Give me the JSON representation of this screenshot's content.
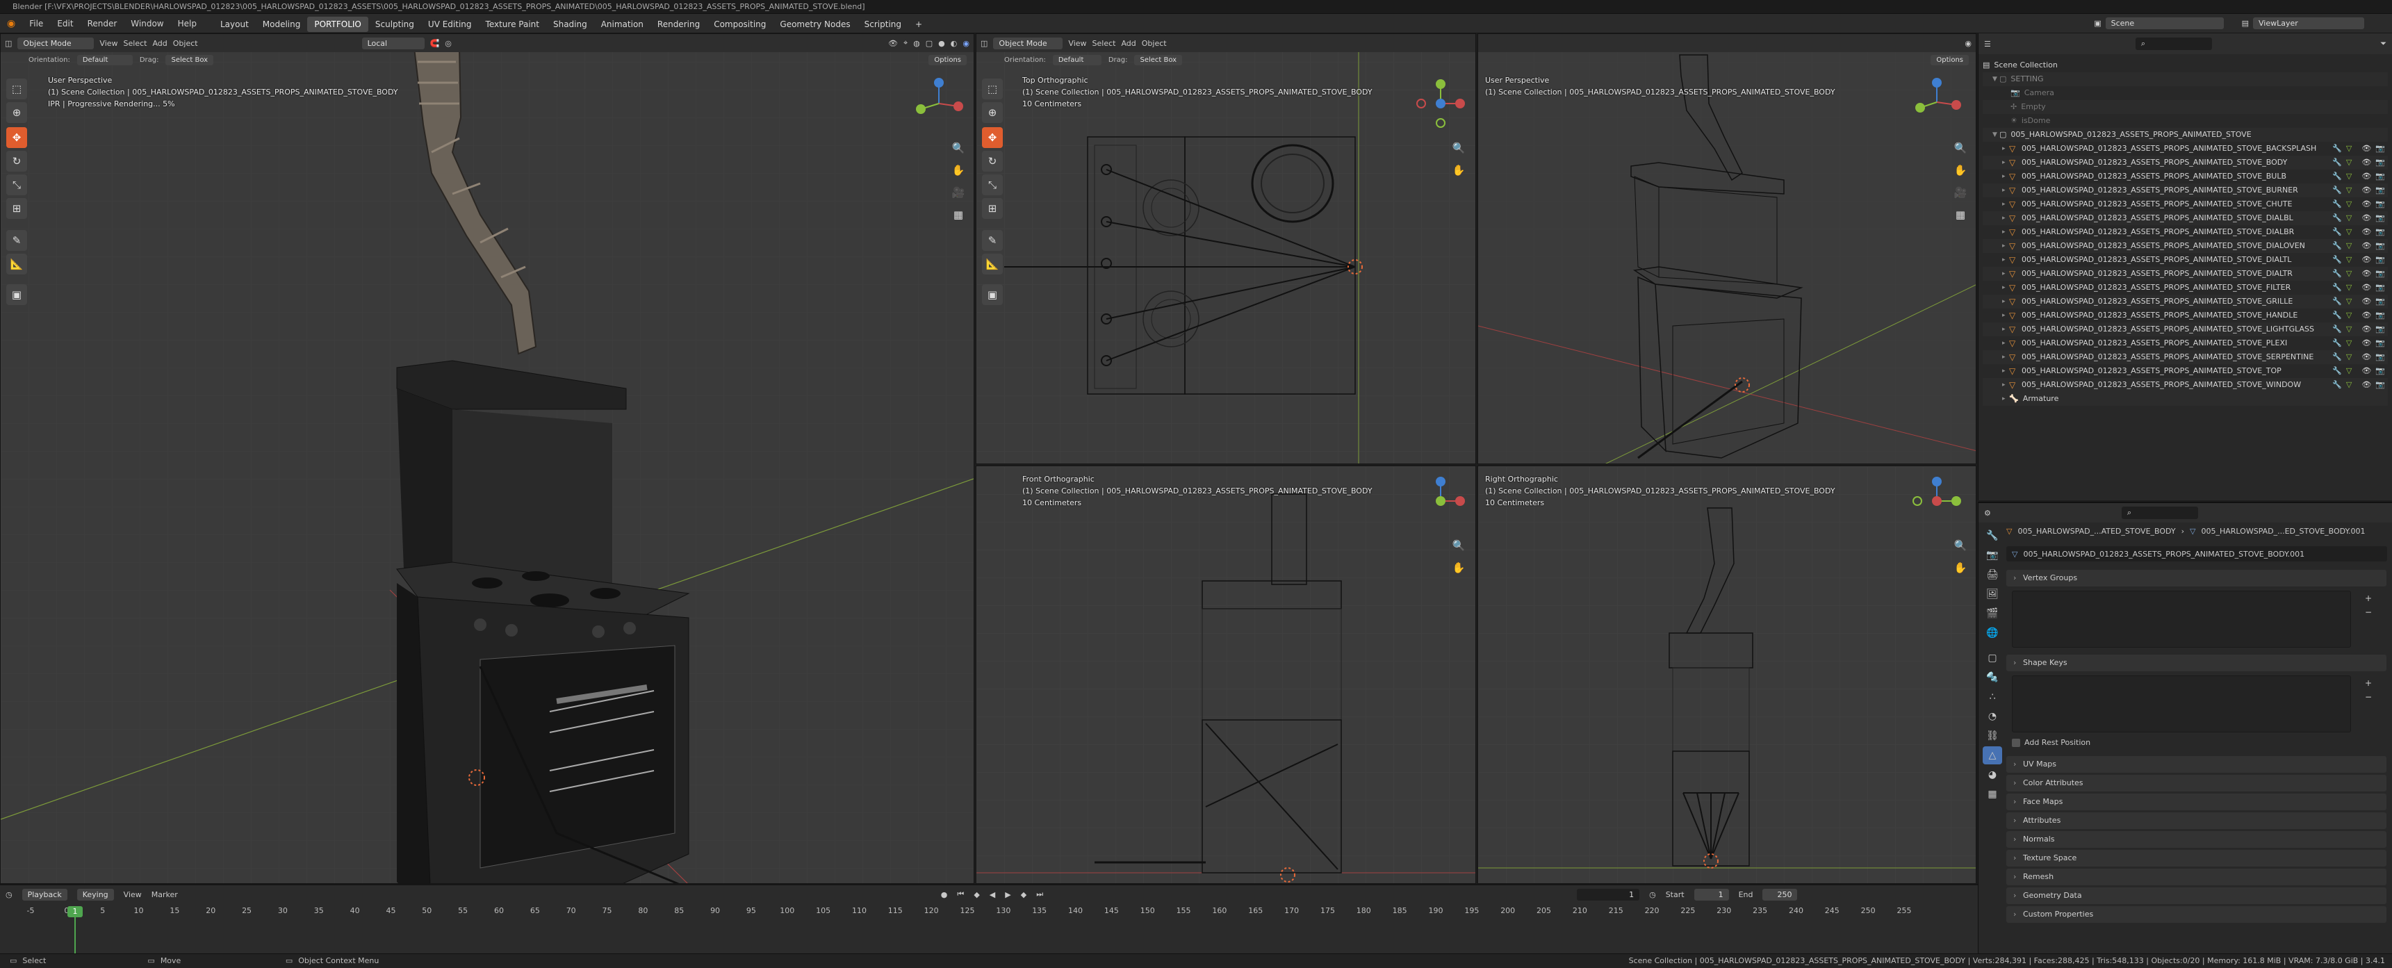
{
  "title": "Blender [F:\\VFX\\PROJECTS\\BLENDER\\HARLOWSPAD_012823\\005_HARLOWSPAD_012823_ASSETS\\005_HARLOWSPAD_012823_ASSETS_PROPS_ANIMATED\\005_HARLOWSPAD_012823_ASSETS_PROPS_ANIMATED_STOVE.blend]",
  "menu": [
    "File",
    "Edit",
    "Render",
    "Window",
    "Help"
  ],
  "workspaces": [
    "Layout",
    "Modeling",
    "PORTFOLIO",
    "Sculpting",
    "UV Editing",
    "Texture Paint",
    "Shading",
    "Animation",
    "Rendering",
    "Compositing",
    "Geometry Nodes",
    "Scripting"
  ],
  "active_workspace": "PORTFOLIO",
  "add_tab": "+",
  "scene": {
    "label": "Scene",
    "view_layer": "ViewLayer"
  },
  "viewport_header": {
    "mode": "Object Mode",
    "menus": [
      "View",
      "Select",
      "Add",
      "Object"
    ],
    "transform": "Local",
    "options": "Options"
  },
  "viewport_header2": {
    "orientation_label": "Orientation:",
    "orientation": "Default",
    "drag_label": "Drag:",
    "drag": "Select Box"
  },
  "viewports": {
    "main": {
      "name": "User Perspective",
      "collection": "(1) Scene Collection | 005_HARLOWSPAD_012823_ASSETS_PROPS_ANIMATED_STOVE_BODY",
      "status": "IPR | Progressive Rendering... 5%"
    },
    "top": {
      "name": "Top Orthographic",
      "collection": "(1) Scene Collection | 005_HARLOWSPAD_012823_ASSETS_PROPS_ANIMATED_STOVE_BODY",
      "scale": "10 Centimeters"
    },
    "persp2": {
      "name": "User Perspective",
      "collection": "(1) Scene Collection | 005_HARLOWSPAD_012823_ASSETS_PROPS_ANIMATED_STOVE_BODY"
    },
    "front": {
      "name": "Front Orthographic",
      "collection": "(1) Scene Collection | 005_HARLOWSPAD_012823_ASSETS_PROPS_ANIMATED_STOVE_BODY",
      "scale": "10 Centimeters"
    },
    "right": {
      "name": "Right Orthographic",
      "collection": "(1) Scene Collection | 005_HARLOWSPAD_012823_ASSETS_PROPS_ANIMATED_STOVE_BODY",
      "scale": "10 Centimeters"
    }
  },
  "outliner": {
    "root": "Scene Collection",
    "setting": "SETTING",
    "setting_items": [
      "Camera",
      "Empty",
      "isDome"
    ],
    "collection": "005_HARLOWSPAD_012823_ASSETS_PROPS_ANIMATED_STOVE",
    "objects": [
      "005_HARLOWSPAD_012823_ASSETS_PROPS_ANIMATED_STOVE_BACKSPLASH",
      "005_HARLOWSPAD_012823_ASSETS_PROPS_ANIMATED_STOVE_BODY",
      "005_HARLOWSPAD_012823_ASSETS_PROPS_ANIMATED_STOVE_BULB",
      "005_HARLOWSPAD_012823_ASSETS_PROPS_ANIMATED_STOVE_BURNER",
      "005_HARLOWSPAD_012823_ASSETS_PROPS_ANIMATED_STOVE_CHUTE",
      "005_HARLOWSPAD_012823_ASSETS_PROPS_ANIMATED_STOVE_DIALBL",
      "005_HARLOWSPAD_012823_ASSETS_PROPS_ANIMATED_STOVE_DIALBR",
      "005_HARLOWSPAD_012823_ASSETS_PROPS_ANIMATED_STOVE_DIALOVEN",
      "005_HARLOWSPAD_012823_ASSETS_PROPS_ANIMATED_STOVE_DIALTL",
      "005_HARLOWSPAD_012823_ASSETS_PROPS_ANIMATED_STOVE_DIALTR",
      "005_HARLOWSPAD_012823_ASSETS_PROPS_ANIMATED_STOVE_FILTER",
      "005_HARLOWSPAD_012823_ASSETS_PROPS_ANIMATED_STOVE_GRILLE",
      "005_HARLOWSPAD_012823_ASSETS_PROPS_ANIMATED_STOVE_HANDLE",
      "005_HARLOWSPAD_012823_ASSETS_PROPS_ANIMATED_STOVE_LIGHTGLASS",
      "005_HARLOWSPAD_012823_ASSETS_PROPS_ANIMATED_STOVE_PLEXI",
      "005_HARLOWSPAD_012823_ASSETS_PROPS_ANIMATED_STOVE_SERPENTINE",
      "005_HARLOWSPAD_012823_ASSETS_PROPS_ANIMATED_STOVE_TOP",
      "005_HARLOWSPAD_012823_ASSETS_PROPS_ANIMATED_STOVE_WINDOW"
    ],
    "armature": "Armature"
  },
  "properties": {
    "breadcrumb_object": "005_HARLOWSPAD_...ATED_STOVE_BODY",
    "breadcrumb_mesh": "005_HARLOWSPAD_...ED_STOVE_BODY.001",
    "mesh_name": "005_HARLOWSPAD_012823_ASSETS_PROPS_ANIMATED_STOVE_BODY.001",
    "vertex_groups": "Vertex Groups",
    "shape_keys": "Shape Keys",
    "add_rest_position": "Add Rest Position",
    "panels": [
      "UV Maps",
      "Color Attributes",
      "Face Maps",
      "Attributes",
      "Normals",
      "Texture Space",
      "Remesh",
      "Geometry Data",
      "Custom Properties"
    ]
  },
  "timeline": {
    "menus": [
      "Playback",
      "Keying",
      "View",
      "Marker"
    ],
    "current_frame": "1",
    "start_label": "Start",
    "start": "1",
    "end_label": "End",
    "end": "250",
    "ticks": [
      "-5",
      "0",
      "5",
      "10",
      "15",
      "20",
      "25",
      "30",
      "35",
      "40",
      "45",
      "50",
      "55",
      "60",
      "65",
      "70",
      "75",
      "80",
      "85",
      "90",
      "95",
      "100",
      "105",
      "110",
      "115",
      "120",
      "125",
      "130",
      "135",
      "140",
      "145",
      "150",
      "155",
      "160",
      "165",
      "170",
      "175",
      "180",
      "185",
      "190",
      "195",
      "200",
      "205",
      "210",
      "215",
      "220",
      "225",
      "230",
      "235",
      "240",
      "245",
      "250",
      "255"
    ]
  },
  "status": {
    "select": "Select",
    "move": "Move",
    "context": "Object Context Menu",
    "info": "Scene Collection | 005_HARLOWSPAD_012823_ASSETS_PROPS_ANIMATED_STOVE_BODY | Verts:284,391 | Faces:288,425 | Tris:548,133 | Objects:0/20 | Memory: 161.8 MiB | VRAM: 7.3/8.0 GiB | 3.4.1"
  },
  "colors": {
    "accent": "#e05d2e",
    "active_blue": "#4772b3",
    "x_axis": "#c84b4b",
    "y_axis": "#8bbf3c",
    "z_axis": "#3f7fd1"
  }
}
